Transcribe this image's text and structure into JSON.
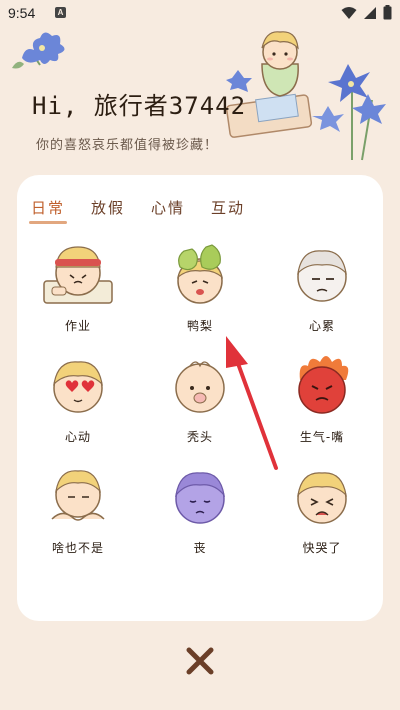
{
  "status": {
    "time": "9:54",
    "notification_letter": "A"
  },
  "greeting": "Hi, 旅行者37442",
  "subtitle": "你的喜怒哀乐都值得被珍藏！",
  "tabs": [
    {
      "label": "日常",
      "active": true
    },
    {
      "label": "放假",
      "active": false
    },
    {
      "label": "心情",
      "active": false
    },
    {
      "label": "互动",
      "active": false
    }
  ],
  "stickers": [
    {
      "label": "作业",
      "icon": "homework-sticker"
    },
    {
      "label": "鸭梨",
      "icon": "pear-stress-sticker"
    },
    {
      "label": "心累",
      "icon": "tired-heart-sticker"
    },
    {
      "label": "心动",
      "icon": "heart-eyes-sticker"
    },
    {
      "label": "秃头",
      "icon": "bald-sticker"
    },
    {
      "label": "生气-嘴",
      "icon": "angry-sticker"
    },
    {
      "label": "啥也不是",
      "icon": "nothing-sticker"
    },
    {
      "label": "丧",
      "icon": "gloomy-sticker"
    },
    {
      "label": "快哭了",
      "icon": "about-to-cry-sticker"
    }
  ],
  "colors": {
    "accent": "#c0602d",
    "background": "#f7ebe0",
    "arrow": "#e0323a"
  }
}
